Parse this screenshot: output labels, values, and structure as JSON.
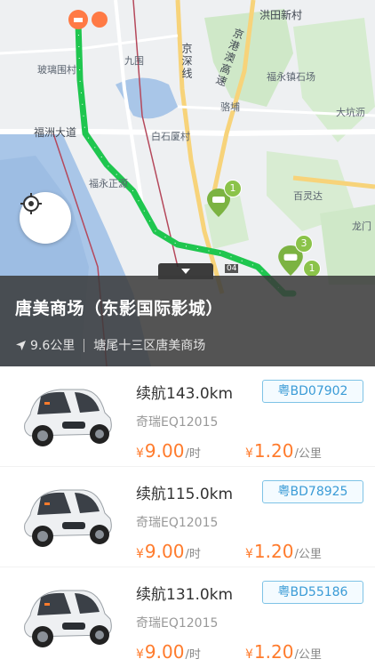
{
  "map": {
    "labels": {
      "hongtian": "洪田新村",
      "jingshen": "京深线",
      "jinggang": "京港澳高速",
      "fuyongshi": "福永镇石场",
      "boli": "玻璃围村",
      "fuzhou": "福洲大道",
      "baishiwei": "白石厦村",
      "qiaotou": "骆埔",
      "dakeng": "大坑沥",
      "fuyongzheng": "福永正源",
      "bailingda": "百灵达",
      "longmen": "龙门",
      "jiuwei": "九围",
      "route_label": "04"
    },
    "clusters": [
      "1",
      "3",
      "1"
    ]
  },
  "info": {
    "title": "唐美商场（东影国际影城）",
    "distance": "9.6公里",
    "address": "塘尾十三区唐美商场"
  },
  "cars": [
    {
      "range": "续航143.0km",
      "plate": "粤BD07902",
      "model": "奇瑞EQ12015",
      "time_price": "9.00",
      "time_unit": "/时",
      "km_price": "1.20",
      "km_unit": "/公里",
      "currency": "¥"
    },
    {
      "range": "续航115.0km",
      "plate": "粤BD78925",
      "model": "奇瑞EQ12015",
      "time_price": "9.00",
      "time_unit": "/时",
      "km_price": "1.20",
      "km_unit": "/公里",
      "currency": "¥"
    },
    {
      "range": "续航131.0km",
      "plate": "粤BD55186",
      "model": "奇瑞EQ12015",
      "time_price": "9.00",
      "time_unit": "/时",
      "km_price": "1.20",
      "km_unit": "/公里",
      "currency": "¥"
    }
  ],
  "colors": {
    "route": "#1fc64f",
    "price": "#ff7b2c",
    "plate": "#3a9bd6",
    "cluster": "#8bc34a"
  }
}
